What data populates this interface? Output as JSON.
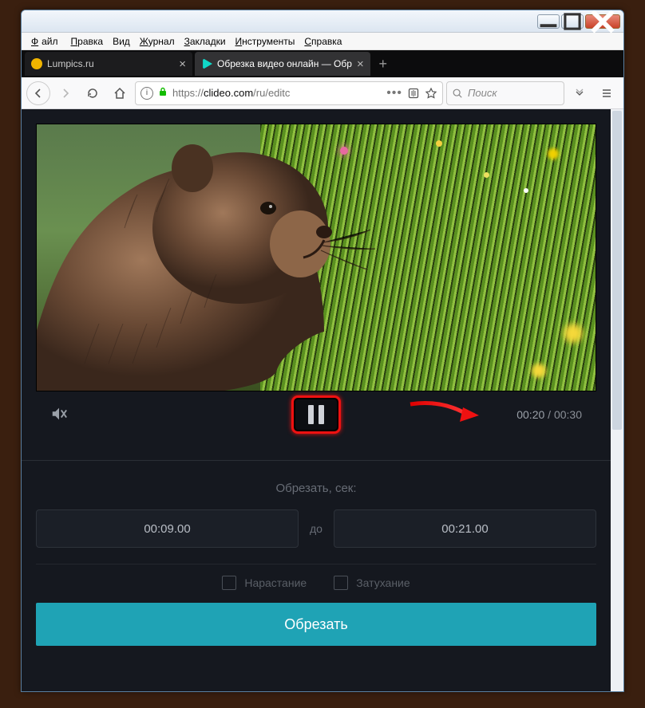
{
  "menu": {
    "file": "Файл",
    "edit": "Правка",
    "view": "Вид",
    "history": "Журнал",
    "bookmarks": "Закладки",
    "tools": "Инструменты",
    "help": "Справка"
  },
  "tabs": {
    "tab1_label": "Lumpics.ru",
    "tab2_label": "Обрезка видео онлайн — Обр"
  },
  "addressbar": {
    "url_prefix": "https://",
    "url_host": "clideo.com",
    "url_rest": "/ru/editc"
  },
  "search": {
    "placeholder": "Поиск"
  },
  "player": {
    "current_time": "00:20",
    "total_time": "00:30",
    "separator": "/"
  },
  "trim": {
    "section_label": "Обрезать, сек:",
    "from_value": "00:09.00",
    "to_label": "до",
    "to_value": "00:21.00"
  },
  "effects": {
    "fadein_label": "Нарастание",
    "fadeout_label": "Затухание"
  },
  "cta": {
    "label": "Обрезать"
  }
}
